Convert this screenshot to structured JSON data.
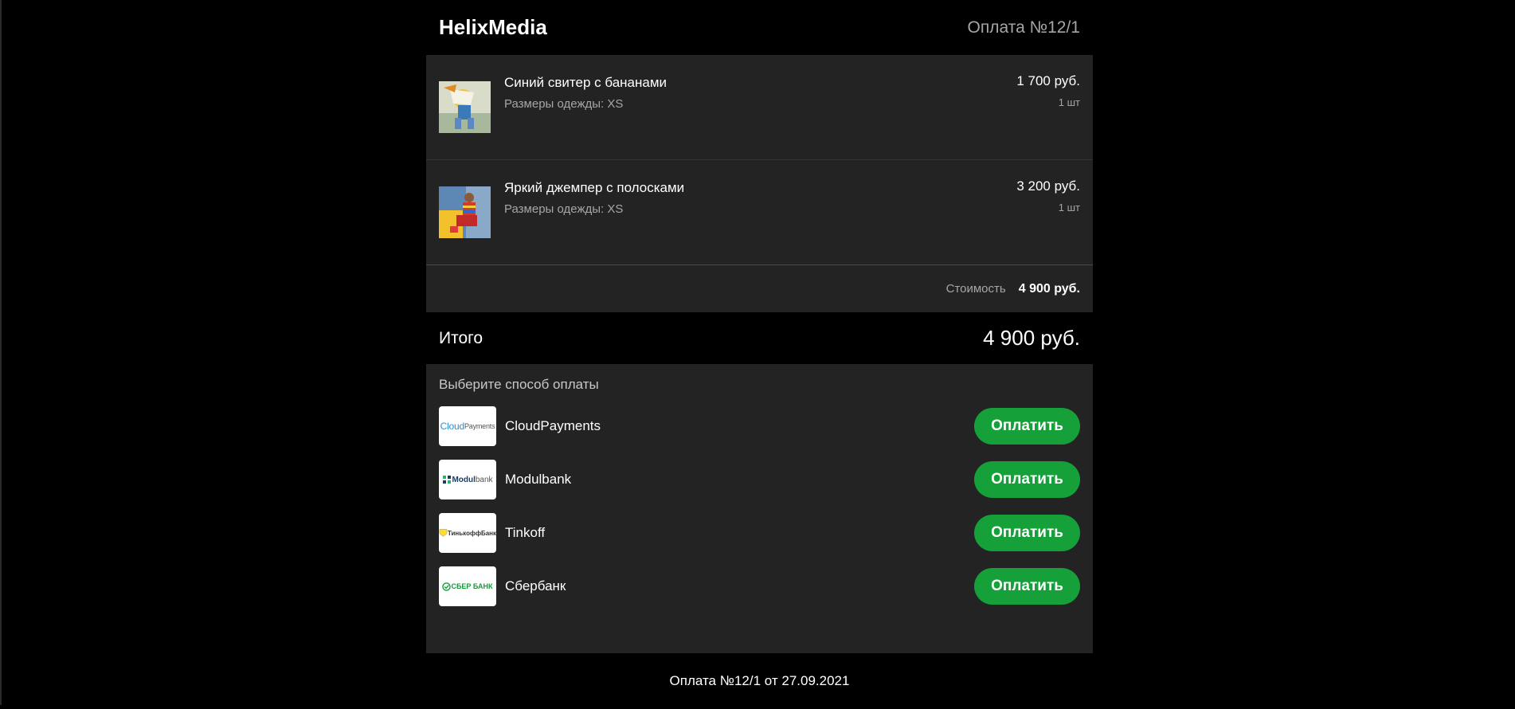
{
  "header": {
    "brand": "HelixMedia",
    "payment_id": "Оплата №12/1"
  },
  "cart": {
    "items": [
      {
        "name": "Синий свитер с бананами",
        "size": "Размеры одежды: XS",
        "price": "1 700 руб.",
        "qty": "1  шт"
      },
      {
        "name": "Яркий джемпер с полосками",
        "size": "Размеры одежды: XS",
        "price": "3 200 руб.",
        "qty": "1  шт"
      }
    ],
    "subtotal_label": "Стоимость",
    "subtotal_value": "4 900 руб."
  },
  "total": {
    "label": "Итого",
    "value": "4 900 руб."
  },
  "methods": {
    "title": "Выберите способ оплаты",
    "items": [
      {
        "name": "CloudPayments",
        "logo_text_1": "Cloud",
        "logo_text_2": "Payments",
        "button": "Оплатить"
      },
      {
        "name": "Modulbank",
        "logo_text_1": "Modul",
        "logo_text_2": "bank",
        "button": "Оплатить"
      },
      {
        "name": "Tinkoff",
        "logo_text_1": "ТинькоффБанк",
        "button": "Оплатить"
      },
      {
        "name": "Сбербанк",
        "logo_text_1": "СБЕР БАНК",
        "button": "Оплатить"
      }
    ]
  },
  "footer": {
    "text": "Оплата №12/1 от 27.09.2021"
  },
  "colors": {
    "background": "#000000",
    "panel": "#232323",
    "pay_button": "#15a03a",
    "muted_text": "#a6a6a6"
  }
}
